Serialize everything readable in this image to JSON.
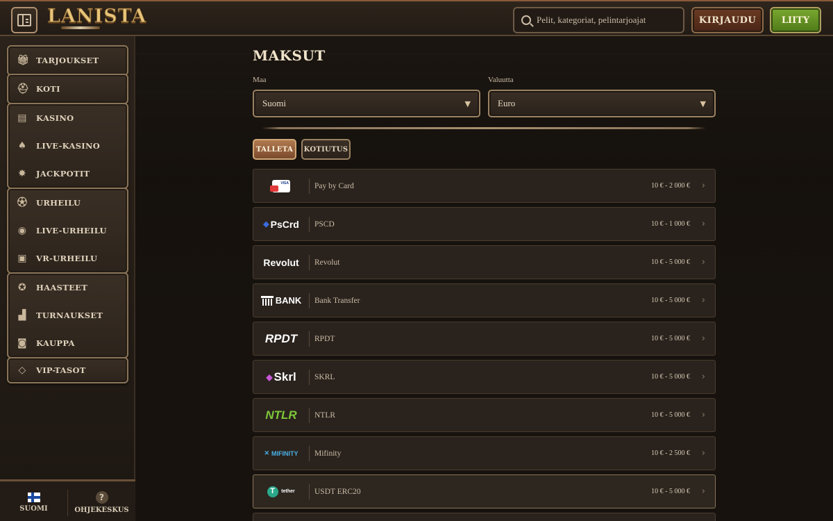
{
  "header": {
    "logo_text": "LANISTA",
    "search_placeholder": "Pelit, kategoriat, pelintarjoajat",
    "login_label": "KIRJAUDU",
    "join_label": "LIITY"
  },
  "sidebar": {
    "groups": [
      [
        {
          "label": "TARJOUKSET",
          "icon": "gift-icon"
        }
      ],
      [
        {
          "label": "KOTI",
          "icon": "helmet-icon"
        }
      ],
      [
        {
          "label": "KASINO",
          "icon": "slot-machine-icon"
        },
        {
          "label": "LIVE-KASINO",
          "icon": "cards-icon"
        },
        {
          "label": "JACKPOTIT",
          "icon": "star-icon"
        }
      ],
      [
        {
          "label": "URHEILU",
          "icon": "ball-icon"
        },
        {
          "label": "LIVE-URHEILU",
          "icon": "live-sport-icon"
        },
        {
          "label": "VR-URHEILU",
          "icon": "vr-icon"
        }
      ],
      [
        {
          "label": "HAASTEET",
          "icon": "medal-icon"
        },
        {
          "label": "TURNAUKSET",
          "icon": "podium-icon"
        },
        {
          "label": "KAUPPA",
          "icon": "bag-icon"
        }
      ],
      [
        {
          "label": "VIP-TASOT",
          "icon": "diamond-icon"
        }
      ]
    ],
    "footer": {
      "language_label": "SUOMI",
      "help_label": "OHJEKESKUS"
    }
  },
  "main": {
    "title": "MAKSUT",
    "country_label": "Maa",
    "country_value": "Suomi",
    "currency_label": "Valuutta",
    "currency_value": "Euro",
    "tabs": {
      "deposit": "TALLETA",
      "withdraw": "KOTIUTUS"
    },
    "payment_methods": [
      {
        "name": "Pay by Card",
        "range": "10 € - 2 000 €",
        "logo": "card"
      },
      {
        "name": "PSCD",
        "range": "10 € - 1 000 €",
        "logo": "PsCrd"
      },
      {
        "name": "Revolut",
        "range": "10 € - 5 000 €",
        "logo": "Revolut"
      },
      {
        "name": "Bank Transfer",
        "range": "10 € - 5 000 €",
        "logo": "BANK"
      },
      {
        "name": "RPDT",
        "range": "10 € - 5 000 €",
        "logo": "RPDT"
      },
      {
        "name": "SKRL",
        "range": "10 € - 5 000 €",
        "logo": "Skrl"
      },
      {
        "name": "NTLR",
        "range": "10 € - 5 000 €",
        "logo": "NTLR"
      },
      {
        "name": "Mifinity",
        "range": "10 € - 2 500 €",
        "logo": "MIFINITY"
      },
      {
        "name": "USDT ERC20",
        "range": "10 € - 5 000 €",
        "logo": "tether"
      }
    ]
  }
}
